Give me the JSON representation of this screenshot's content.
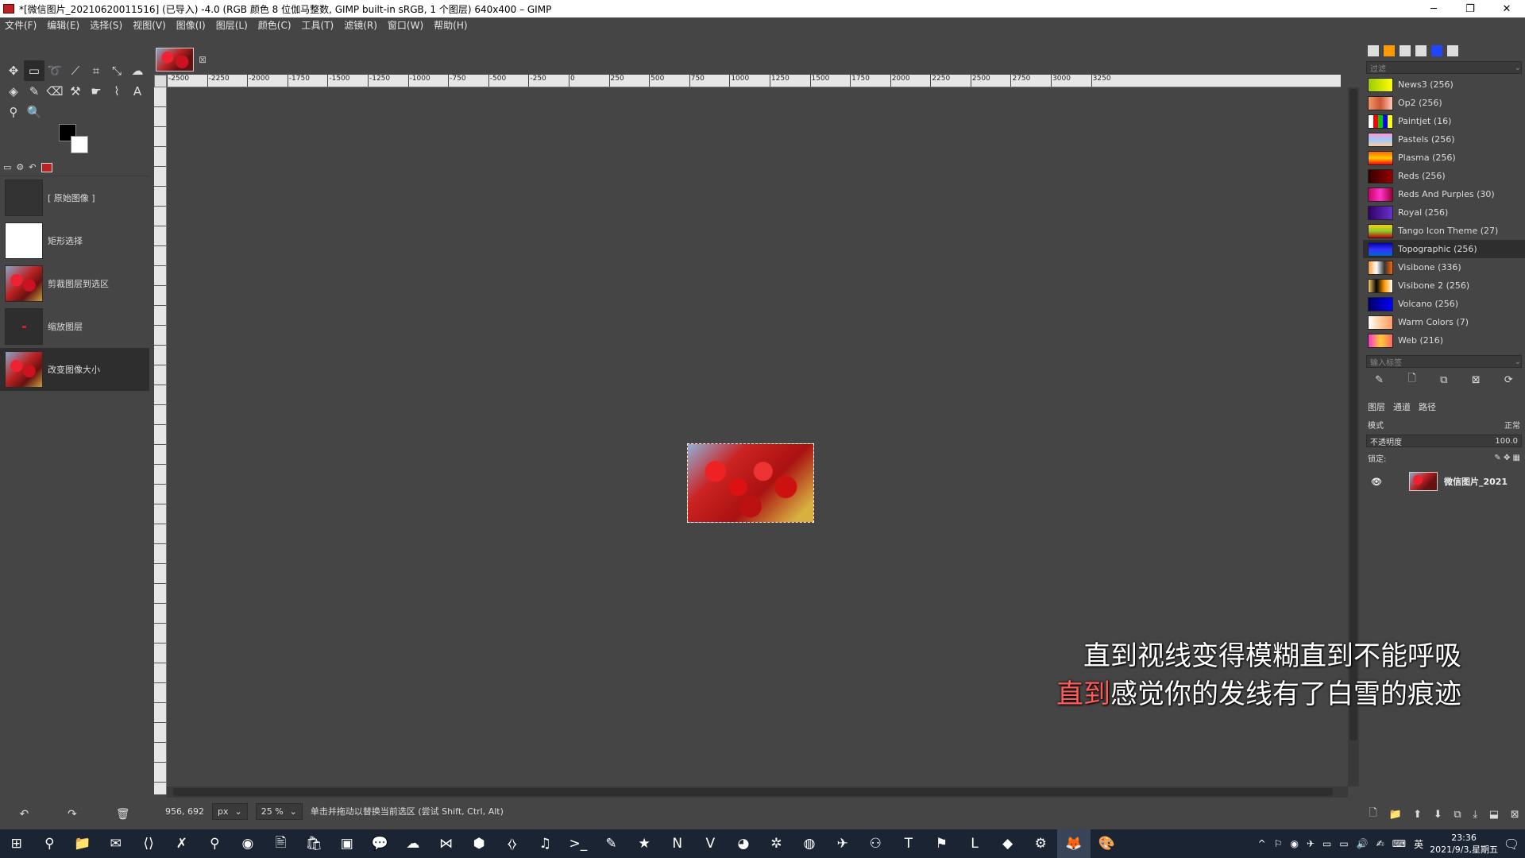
{
  "window": {
    "title": "*[微信图片_20210620011516] (已导入) -4.0 (RGB 颜色 8 位伽马整数, GIMP built-in sRGB, 1 个图层) 640x400 – GIMP",
    "minimize": "─",
    "maximize": "❐",
    "close": "✕"
  },
  "menu": [
    "文件(F)",
    "编辑(E)",
    "选择(S)",
    "视图(V)",
    "图像(I)",
    "图层(L)",
    "颜色(C)",
    "工具(T)",
    "滤镜(R)",
    "窗口(W)",
    "帮助(H)"
  ],
  "tools": [
    {
      "name": "move-tool-icon",
      "glyph": "✥"
    },
    {
      "name": "rect-select-tool-icon",
      "glyph": "▭",
      "selected": true
    },
    {
      "name": "lasso-tool-icon",
      "glyph": "➰"
    },
    {
      "name": "fuzzy-select-tool-icon",
      "glyph": "⟋"
    },
    {
      "name": "crop-tool-icon",
      "glyph": "⌗"
    },
    {
      "name": "transform-tool-icon",
      "glyph": "⤡"
    },
    {
      "name": "warp-tool-icon",
      "glyph": "☁"
    },
    {
      "name": "bucket-fill-tool-icon",
      "glyph": "◈"
    },
    {
      "name": "paintbrush-tool-icon",
      "glyph": "✎"
    },
    {
      "name": "eraser-tool-icon",
      "glyph": "⌫"
    },
    {
      "name": "clone-tool-icon",
      "glyph": "⚒"
    },
    {
      "name": "smudge-tool-icon",
      "glyph": "☛"
    },
    {
      "name": "paths-tool-icon",
      "glyph": "⌇"
    },
    {
      "name": "text-tool-icon",
      "glyph": "A"
    },
    {
      "name": "color-picker-tool-icon",
      "glyph": "⚲"
    },
    {
      "name": "zoom-tool-icon",
      "glyph": "🔍"
    }
  ],
  "history": {
    "items": [
      {
        "label": "[ 原始图像 ]",
        "thumb": "dark-empty"
      },
      {
        "label": "矩形选择",
        "thumb": "white"
      },
      {
        "label": "剪裁图层到选区",
        "thumb": "berry"
      },
      {
        "label": "缩放图层",
        "thumb": "dark"
      },
      {
        "label": "改变图像大小",
        "thumb": "berry",
        "selected": true
      }
    ],
    "undo": "↶",
    "redo": "↷",
    "clear": "🗑"
  },
  "rulers": {
    "horizontal": [
      "-2500",
      "-2250",
      "-2000",
      "-1750",
      "-1500",
      "-1250",
      "-1000",
      "-750",
      "-500",
      "-250",
      "0",
      "250",
      "500",
      "750",
      "1000",
      "1250",
      "1500",
      "1750",
      "2000",
      "2250",
      "2500",
      "2750",
      "3000",
      "3250"
    ]
  },
  "status": {
    "coords": "956, 692",
    "unit": "px",
    "zoom": "25 %",
    "message": "单击并拖动以替换当前选区 (尝试 Shift, Ctrl, Alt)"
  },
  "palettes": {
    "filter_placeholder": "过滤",
    "tag_placeholder": "输入标签",
    "items": [
      {
        "label": "News3 (256)",
        "swatch": "linear-gradient(90deg,#9c0,#ff0)"
      },
      {
        "label": "Op2 (256)",
        "swatch": "linear-gradient(90deg,#e96,#c53,#fcb)"
      },
      {
        "label": "Paintjet (16)",
        "swatch": "linear-gradient(90deg,#fff 20%,#f00 20% 40%,#0c0 40% 60%,#00f 60% 80%,#ff0 80%)"
      },
      {
        "label": "Pastels (256)",
        "swatch": "linear-gradient(180deg,#f9c,#9cf,#fc9)"
      },
      {
        "label": "Plasma (256)",
        "swatch": "linear-gradient(180deg,#f60,#fc0,#f00)"
      },
      {
        "label": "Reds (256)",
        "swatch": "linear-gradient(90deg,#300,#900)"
      },
      {
        "label": "Reds And Purples (30)",
        "swatch": "linear-gradient(90deg,#c06,#f3c,#903)"
      },
      {
        "label": "Royal (256)",
        "swatch": "linear-gradient(90deg,#306,#63c)"
      },
      {
        "label": "Tango Icon Theme (27)",
        "swatch": "linear-gradient(180deg,#fc0,#8c3,#c00)"
      },
      {
        "label": "Topographic (256)",
        "swatch": "linear-gradient(180deg,#00a,#33f,#06c)",
        "selected": true
      },
      {
        "label": "Visibone (336)",
        "swatch": "linear-gradient(90deg,#f93,#fff,#333,#f60)"
      },
      {
        "label": "Visibone 2 (256)",
        "swatch": "linear-gradient(90deg,#fc6,#000,#f90,#fff)"
      },
      {
        "label": "Volcano (256)",
        "swatch": "linear-gradient(90deg,#006,#00f)"
      },
      {
        "label": "Warm Colors (7)",
        "swatch": "linear-gradient(90deg,#fff,#fc9,#f96)"
      },
      {
        "label": "Web (216)",
        "swatch": "linear-gradient(90deg,#f3c,#fc3,#f66)"
      }
    ],
    "toolbar": [
      "✎",
      "🗋",
      "⧉",
      "⊠",
      "⟳"
    ]
  },
  "layers": {
    "tabs": [
      "图层",
      "通道",
      "路径"
    ],
    "mode_label": "模式",
    "mode_value": "正常",
    "opacity_label": "不透明度",
    "opacity_value": "100.0",
    "lock_label": "锁定:",
    "layer_name": "微信图片_2021",
    "bottom_tools": [
      "🗋",
      "📁",
      "⬆",
      "⬇",
      "⧉",
      "⤓",
      "⬓",
      "⊠"
    ]
  },
  "subtitles": {
    "line1": "直到视线变得模糊直到不能呼吸",
    "line2_highlight": "直到",
    "line2_rest": "感觉你的发线有了白雪的痕迹"
  },
  "taskbar": {
    "apps": [
      {
        "name": "start-icon",
        "glyph": "⊞"
      },
      {
        "name": "search-icon",
        "glyph": "⚲"
      },
      {
        "name": "file-explorer-icon",
        "glyph": "📁"
      },
      {
        "name": "mail-icon",
        "glyph": "✉"
      },
      {
        "name": "vscode-icon",
        "glyph": "⟨⟩"
      },
      {
        "name": "xcode-icon",
        "glyph": "✗"
      },
      {
        "name": "search-app-icon",
        "glyph": "⚲"
      },
      {
        "name": "chrome-icon",
        "glyph": "◉"
      },
      {
        "name": "notepad-icon",
        "glyph": "🖹"
      },
      {
        "name": "store-icon",
        "glyph": "🛍"
      },
      {
        "name": "photos-icon",
        "glyph": "▣"
      },
      {
        "name": "wechat-icon",
        "glyph": "💬"
      },
      {
        "name": "cloud-icon",
        "glyph": "☁"
      },
      {
        "name": "visual-studio-icon",
        "glyph": "⋈"
      },
      {
        "name": "app-hexagon-icon",
        "glyph": "⬢"
      },
      {
        "name": "code-editor-icon",
        "glyph": "⧼⧽"
      },
      {
        "name": "netease-music-icon",
        "glyph": "♫"
      },
      {
        "name": "terminal-icon",
        "glyph": ">_"
      },
      {
        "name": "notepad-plus-icon",
        "glyph": "✎"
      },
      {
        "name": "star-app-icon",
        "glyph": "★"
      },
      {
        "name": "onenote-icon",
        "glyph": "N"
      },
      {
        "name": "vs-blend-icon",
        "glyph": "V"
      },
      {
        "name": "gimp-alt-icon",
        "glyph": "◕"
      },
      {
        "name": "settings-wheel-icon",
        "glyph": "✲"
      },
      {
        "name": "spotify-icon",
        "glyph": "◍"
      },
      {
        "name": "feather-icon",
        "glyph": "✈"
      },
      {
        "name": "disk-icon",
        "glyph": "⚇"
      },
      {
        "name": "typora-icon",
        "glyph": "T"
      },
      {
        "name": "fluent-icon",
        "glyph": "⚑"
      },
      {
        "name": "app-l-icon",
        "glyph": "L"
      },
      {
        "name": "vs-purple-icon",
        "glyph": "◆"
      },
      {
        "name": "gear-icon",
        "glyph": "⚙"
      },
      {
        "name": "gimp-icon",
        "glyph": "🦊",
        "active": true
      },
      {
        "name": "paint-icon",
        "glyph": "🎨"
      }
    ],
    "tray": [
      "^",
      "⚐",
      "◉",
      "✈",
      "▭",
      "▭",
      "🔊",
      "✍",
      "⌨",
      "英"
    ],
    "time": "23:36",
    "date": "2021/9/3,星期五",
    "notification": "🗨",
    "notification_count": "1"
  }
}
